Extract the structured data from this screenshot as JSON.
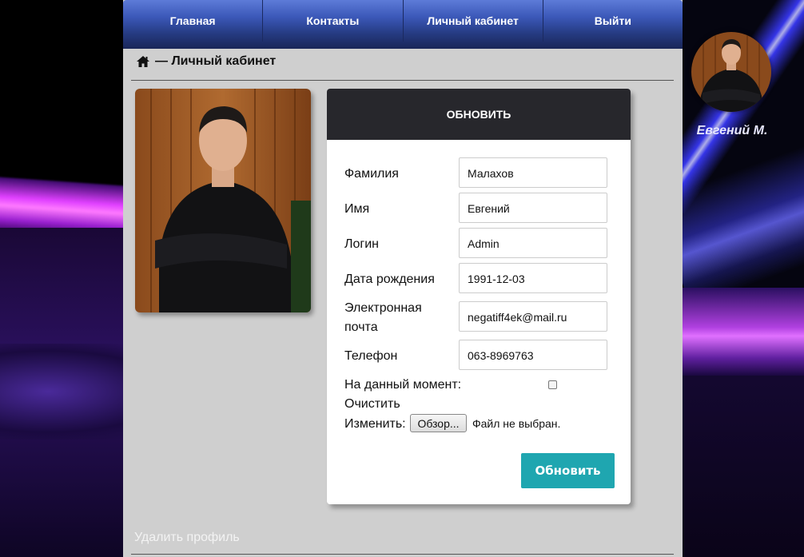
{
  "nav": {
    "items": [
      {
        "label": "Главная"
      },
      {
        "label": "Контакты"
      },
      {
        "label": "Личный кабинет"
      },
      {
        "label": "Выйти"
      }
    ]
  },
  "breadcrumb": {
    "text": "— Личный кабинет",
    "icon": "home-icon"
  },
  "card": {
    "title": "ОБНОВИТЬ",
    "fields": [
      {
        "label": "Фамилия",
        "value": "Малахов"
      },
      {
        "label": "Имя",
        "value": "Евгений"
      },
      {
        "label": "Логин",
        "value": "Admin"
      },
      {
        "label": "Дата рождения",
        "value": "1991-12-03"
      },
      {
        "label": "Электронная почта",
        "value": "negatiff4ek@mail.ru"
      },
      {
        "label": "Телефон",
        "value": "063-8969763"
      }
    ],
    "current_label": "На данный момент:",
    "clear_label": "Очистить",
    "change_label": "Изменить:",
    "browse_label": "Обзор...",
    "file_status": "Файл не выбран.",
    "submit_label": "Обновить"
  },
  "delete_profile_label": "Удалить профиль",
  "user": {
    "name": "Евгений М."
  },
  "colors": {
    "nav_top": "#5d7bd8",
    "nav_bottom": "#1a2658",
    "card_header": "#27272c",
    "submit": "#1fa6b0",
    "panel": "#cfcfcf"
  }
}
